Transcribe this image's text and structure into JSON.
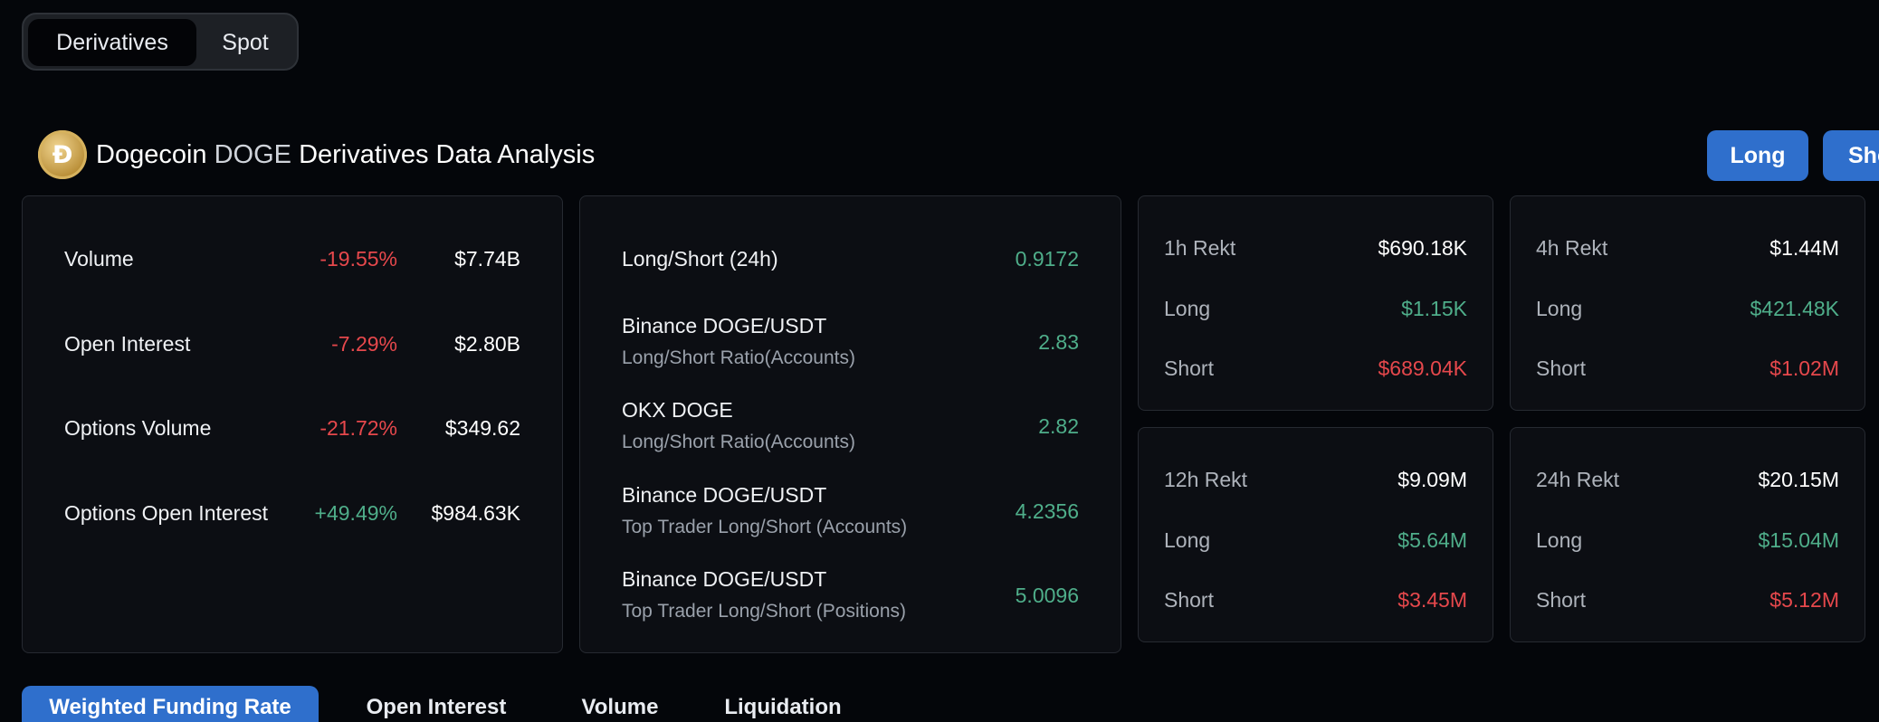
{
  "tabs_top": {
    "derivatives": "Derivatives",
    "spot": "Spot"
  },
  "header": {
    "coin_name": "Dogecoin",
    "coin_symbol": "DOGE",
    "title_rest": "Derivatives Data Analysis",
    "logo_letter": "Ð"
  },
  "buttons": {
    "long": "Long",
    "short": "Short"
  },
  "metrics": [
    {
      "label": "Volume",
      "change": "-19.55%",
      "value": "$7.74B"
    },
    {
      "label": "Open Interest",
      "change": "-7.29%",
      "value": "$2.80B"
    },
    {
      "label": "Options Volume",
      "change": "-21.72%",
      "value": "$349.62"
    },
    {
      "label": "Options Open Interest",
      "change": "+49.49%",
      "value": "$984.63K"
    }
  ],
  "long_short": {
    "headline_label": "Long/Short (24h)",
    "headline_value": "0.9172",
    "rows": [
      {
        "line1": "Binance DOGE/USDT",
        "line2": "Long/Short Ratio(Accounts)",
        "value": "2.83"
      },
      {
        "line1": "OKX DOGE",
        "line2": "Long/Short Ratio(Accounts)",
        "value": "2.82"
      },
      {
        "line1": "Binance DOGE/USDT",
        "line2": "Top Trader Long/Short (Accounts)",
        "value": "4.2356"
      },
      {
        "line1": "Binance DOGE/USDT",
        "line2": "Top Trader Long/Short (Positions)",
        "value": "5.0096"
      }
    ]
  },
  "rekt": [
    {
      "title": "1h Rekt",
      "total": "$690.18K",
      "long_label": "Long",
      "long": "$1.15K",
      "short_label": "Short",
      "short": "$689.04K"
    },
    {
      "title": "4h Rekt",
      "total": "$1.44M",
      "long_label": "Long",
      "long": "$421.48K",
      "short_label": "Short",
      "short": "$1.02M"
    },
    {
      "title": "12h Rekt",
      "total": "$9.09M",
      "long_label": "Long",
      "long": "$5.64M",
      "short_label": "Short",
      "short": "$3.45M"
    },
    {
      "title": "24h Rekt",
      "total": "$20.15M",
      "long_label": "Long",
      "long": "$15.04M",
      "short_label": "Short",
      "short": "$5.12M"
    }
  ],
  "bottom_tabs": [
    "Weighted Funding Rate",
    "Open Interest",
    "Volume",
    "Liquidation"
  ],
  "colors": {
    "accent_blue": "#2f6fcc",
    "negative_red": "#e6484c",
    "positive_green": "#4fae8a",
    "background": "#04060a"
  }
}
